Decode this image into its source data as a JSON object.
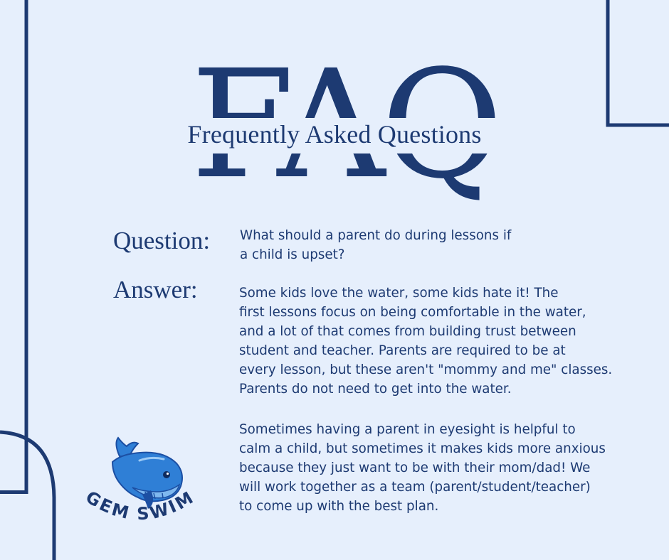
{
  "heading": {
    "watermark": "FAQ",
    "subtitle": "Frequently Asked Questions"
  },
  "question": {
    "label": "Question:",
    "lines": [
      "What should a parent do during lessons if",
      "a child is upset?"
    ]
  },
  "answer": {
    "label": "Answer:",
    "paragraph_1": [
      "Some kids love the water, some kids hate it!  The",
      "first lessons focus on being comfortable in the water,",
      "and a lot of that comes from building trust between",
      "student and teacher.  Parents are required to be at",
      "every lesson, but these aren't \"mommy and me\" classes.",
      "Parents do not need to get into the water."
    ],
    "paragraph_2": [
      "Sometimes having a parent in eyesight is helpful to",
      "calm a child, but sometimes it makes kids more anxious",
      "because they just want to be with their mom/dad! We",
      "will work together as a team (parent/student/teacher)",
      "to come up with the best plan."
    ]
  },
  "logo": {
    "text": "GEM SWIM",
    "icon": "whale-icon"
  },
  "colors": {
    "background": "#e6effc",
    "navy": "#1d3a72",
    "whale_blue": "#2f7fd6",
    "whale_dark": "#1c4fa3"
  }
}
